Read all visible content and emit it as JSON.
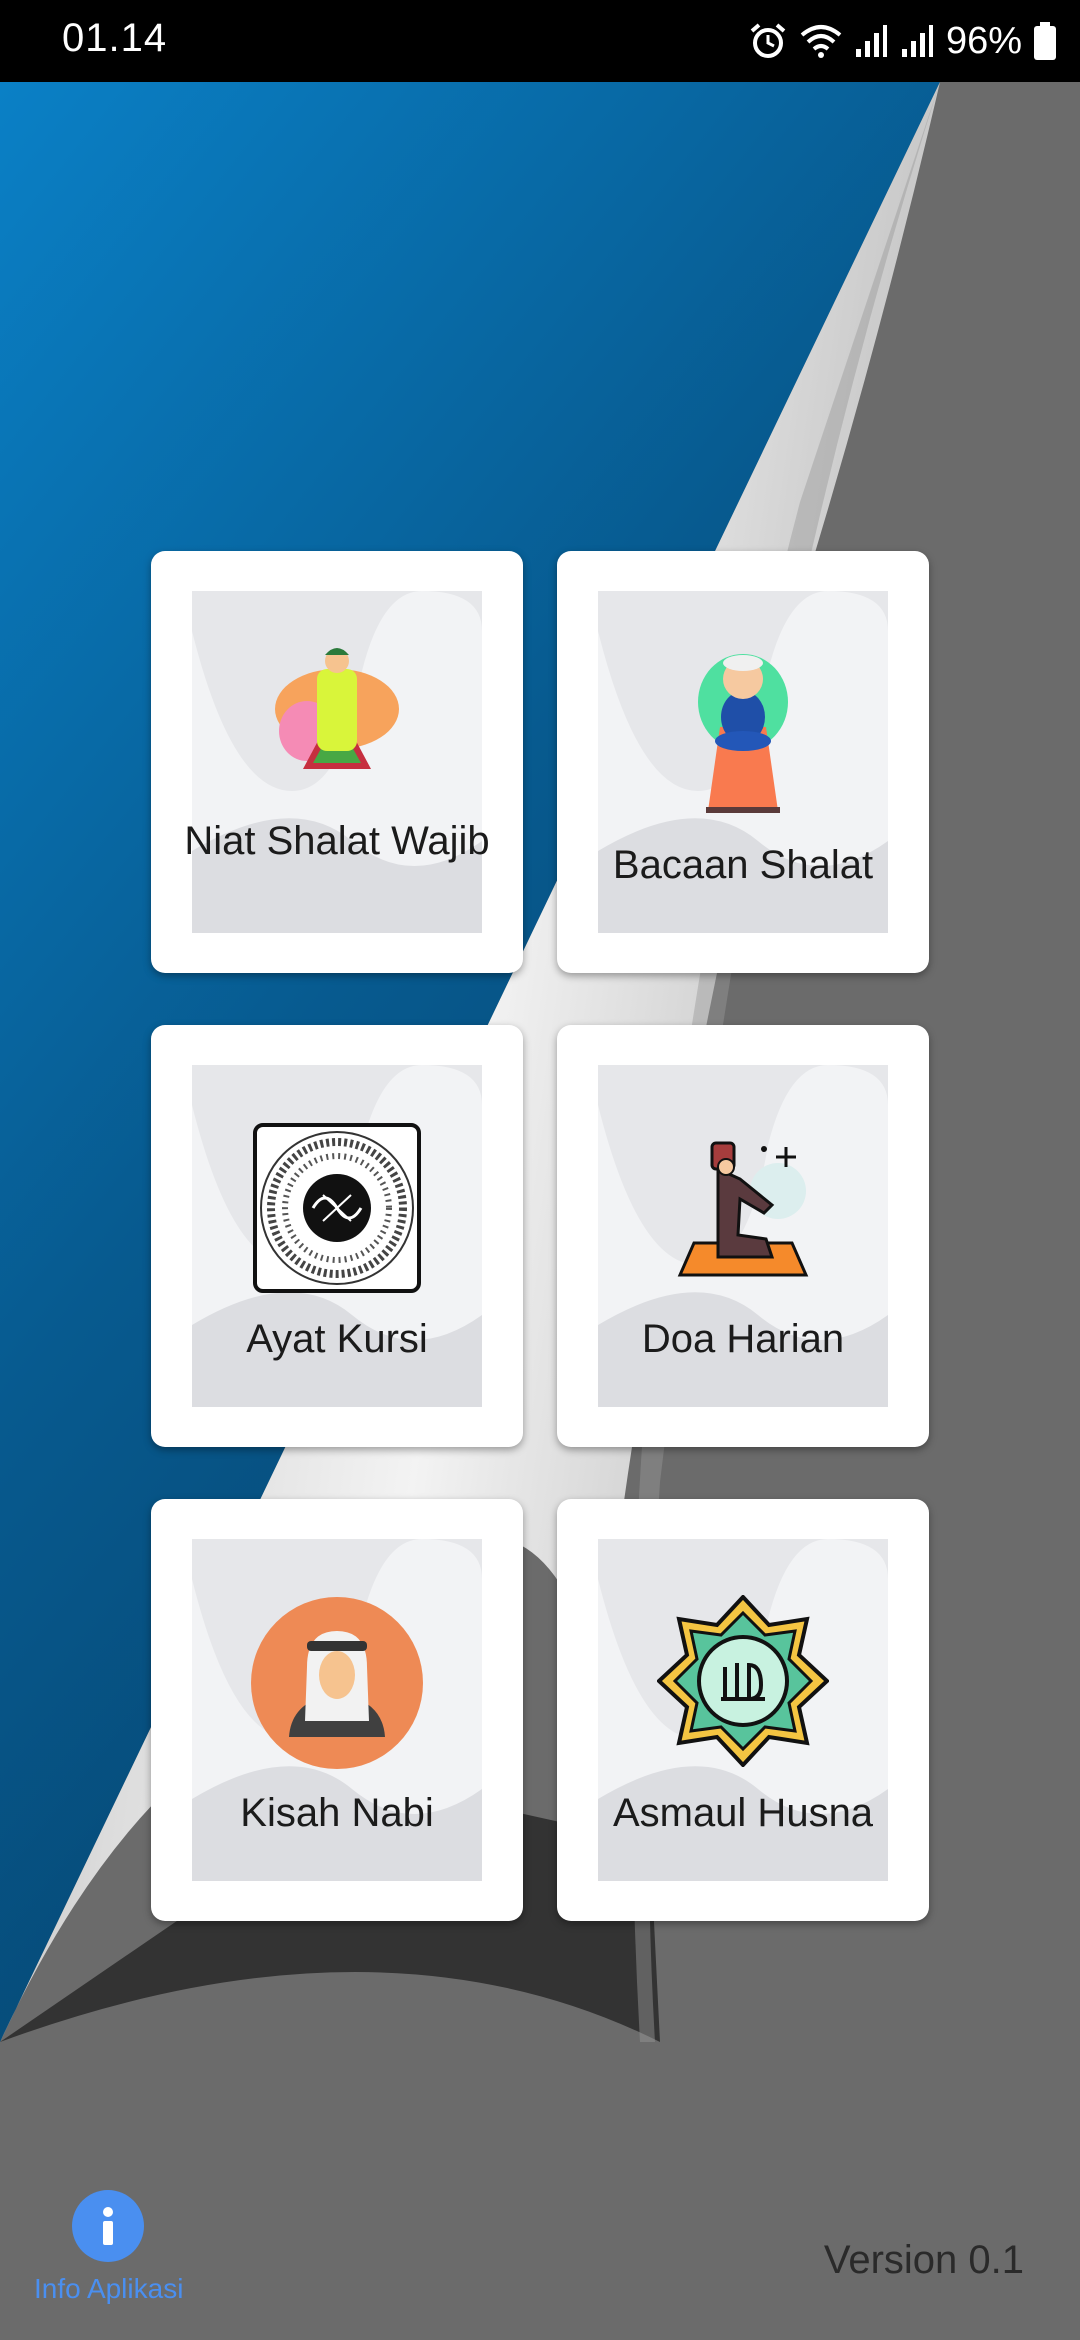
{
  "status_bar": {
    "time": "01.14",
    "battery": "96%",
    "icons": [
      "alarm-icon",
      "wifi-icon",
      "signal-icon",
      "signal-icon",
      "battery-icon"
    ]
  },
  "menu": {
    "items": [
      {
        "label": "Niat Shalat Wajib",
        "icon": "praying-man-icon"
      },
      {
        "label": "Bacaan Shalat",
        "icon": "sitting-prayer-icon"
      },
      {
        "label": "Ayat Kursi",
        "icon": "calligraphy-icon"
      },
      {
        "label": "Doa Harian",
        "icon": "dua-prayer-icon"
      },
      {
        "label": "Kisah Nabi",
        "icon": "prophet-icon"
      },
      {
        "label": "Asmaul Husna",
        "icon": "allah-calligraphy-icon"
      }
    ]
  },
  "footer": {
    "info_label": "Info Aplikasi",
    "version": "Version 0.1"
  },
  "colors": {
    "blue_top": "#0a7cc2",
    "blue_bottom": "#07456e",
    "gray": "#6b6b6b",
    "dark": "#333333",
    "info_blue": "#4a8ff0"
  }
}
